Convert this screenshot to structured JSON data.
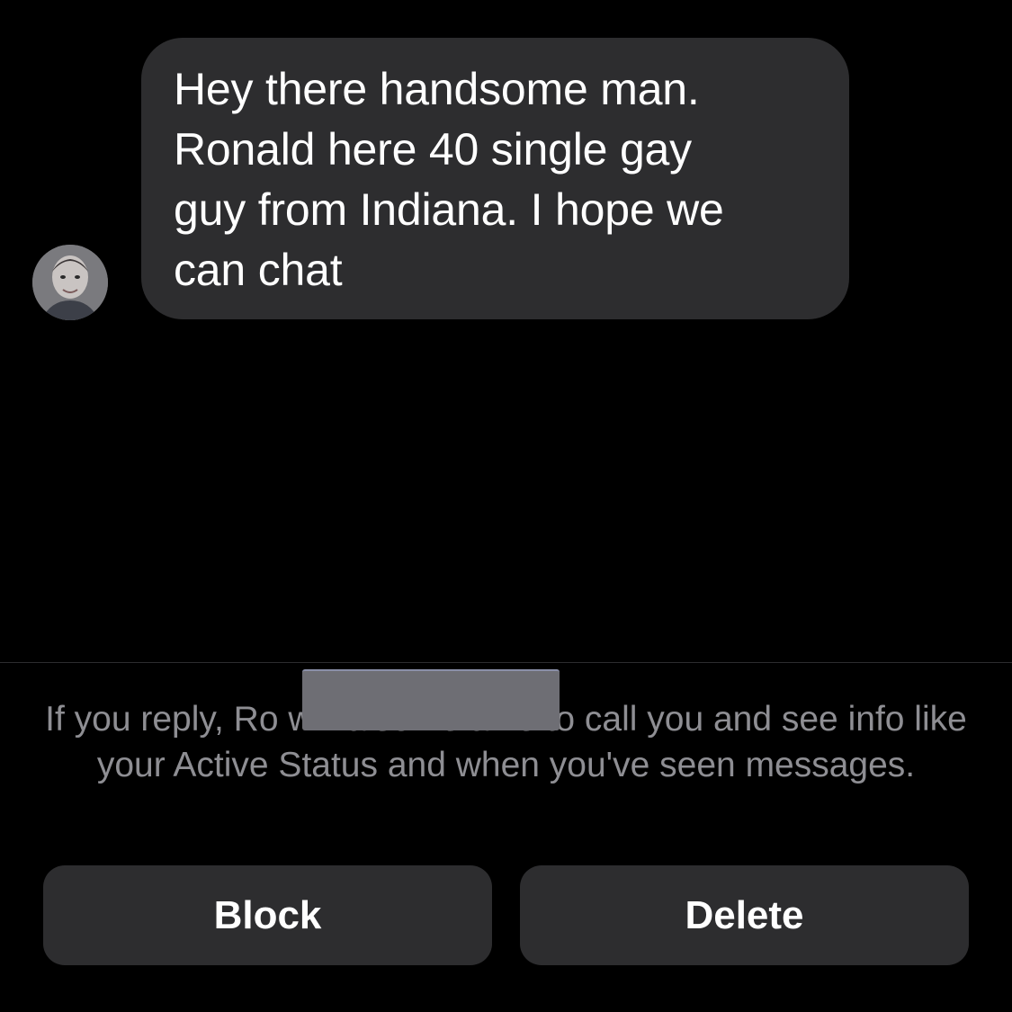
{
  "conversation": {
    "sender_avatar": "profile-photo",
    "message_text": "Hey there handsome man.\nRonald here 40 single gay\nguy from Indiana.  I hope we\ncan chat"
  },
  "request_notice": {
    "text": "If you reply, Ro                          will also be able to call you and see info like your Active Status and when you've seen messages."
  },
  "actions": {
    "block_label": "Block",
    "delete_label": "Delete"
  },
  "colors": {
    "background": "#000000",
    "bubble": "#2d2d2f",
    "button": "#2d2d2f",
    "notice_text": "#8e8e93",
    "redaction": "#6e6e74"
  }
}
